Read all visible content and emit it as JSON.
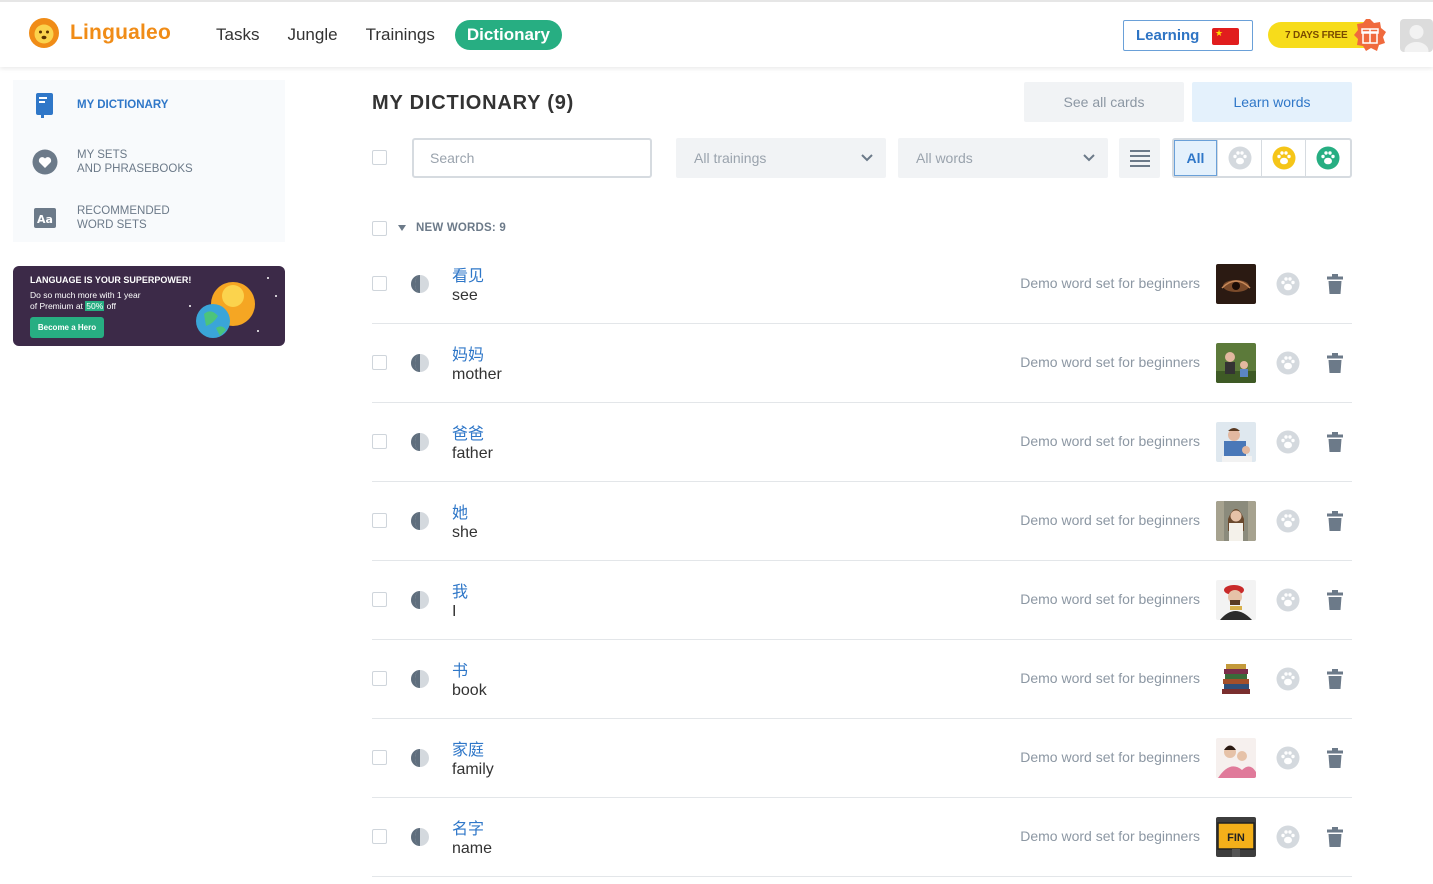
{
  "header": {
    "logo_text": "Lingualeo",
    "nav": [
      "Tasks",
      "Jungle",
      "Trainings",
      "Dictionary"
    ],
    "active_nav": "Dictionary",
    "learning_label": "Learning",
    "free_badge": "7 DAYS FREE"
  },
  "sidebar": {
    "items": [
      {
        "label": "MY DICTIONARY",
        "icon": "book-icon",
        "active": true
      },
      {
        "label": "MY SETS\nAND PHRASEBOOKS",
        "icon": "heart-icon",
        "active": false
      },
      {
        "label": "RECOMMENDED\nWORD SETS",
        "icon": "word-sets-icon",
        "active": false
      }
    ]
  },
  "promo": {
    "headline": "LANGUAGE IS YOUR SUPERPOWER!",
    "line1": "Do so much more with 1 year",
    "line2_prefix": "of Premium at ",
    "line2_highlight": "50%",
    "line2_suffix": " off",
    "button": "Become a Hero"
  },
  "main": {
    "title": "MY DICTIONARY (9)",
    "see_all_cards": "See all cards",
    "learn_words": "Learn words",
    "search_placeholder": "Search",
    "trainings_dropdown": "All trainings",
    "words_dropdown": "All words",
    "filter_all": "All",
    "group_label": "NEW WORDS: 9",
    "words": [
      {
        "word": "看见",
        "translation": "see",
        "set": "Demo word set for beginners",
        "image": "eye-photo"
      },
      {
        "word": "妈妈",
        "translation": "mother",
        "set": "Demo word set for beginners",
        "image": "mother-photo"
      },
      {
        "word": "爸爸",
        "translation": "father",
        "set": "Demo word set for beginners",
        "image": "father-photo"
      },
      {
        "word": "她",
        "translation": "she",
        "set": "Demo word set for beginners",
        "image": "woman-photo"
      },
      {
        "word": "我",
        "translation": "I",
        "set": "Demo word set for beginners",
        "image": "man-photo"
      },
      {
        "word": "书",
        "translation": "book",
        "set": "Demo word set for beginners",
        "image": "books-photo"
      },
      {
        "word": "家庭",
        "translation": "family",
        "set": "Demo word set for beginners",
        "image": "family-photo"
      },
      {
        "word": "名字",
        "translation": "name",
        "set": "Demo word set for beginners",
        "image": "name-sign-photo"
      }
    ],
    "name_sign_text": "FIN"
  },
  "colors": {
    "accent_green": "#27ae82",
    "accent_blue": "#2f77c8",
    "logo_orange": "#f08c17",
    "badge_yellow": "#f7dc1b"
  }
}
